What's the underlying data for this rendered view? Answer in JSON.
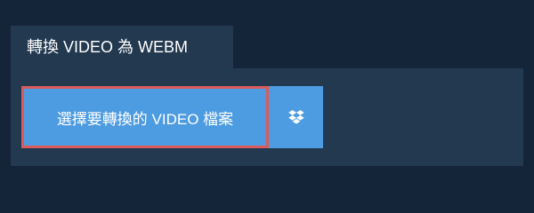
{
  "tab": {
    "label": "轉換 VIDEO 為 WEBM"
  },
  "upload": {
    "choose_label": "選擇要轉換的 VIDEO 檔案",
    "dropbox_icon": "dropbox-icon"
  },
  "colors": {
    "background": "#14253a",
    "panel": "#233950",
    "button": "#4d9be0",
    "focus_outline": "#d95b5b"
  }
}
